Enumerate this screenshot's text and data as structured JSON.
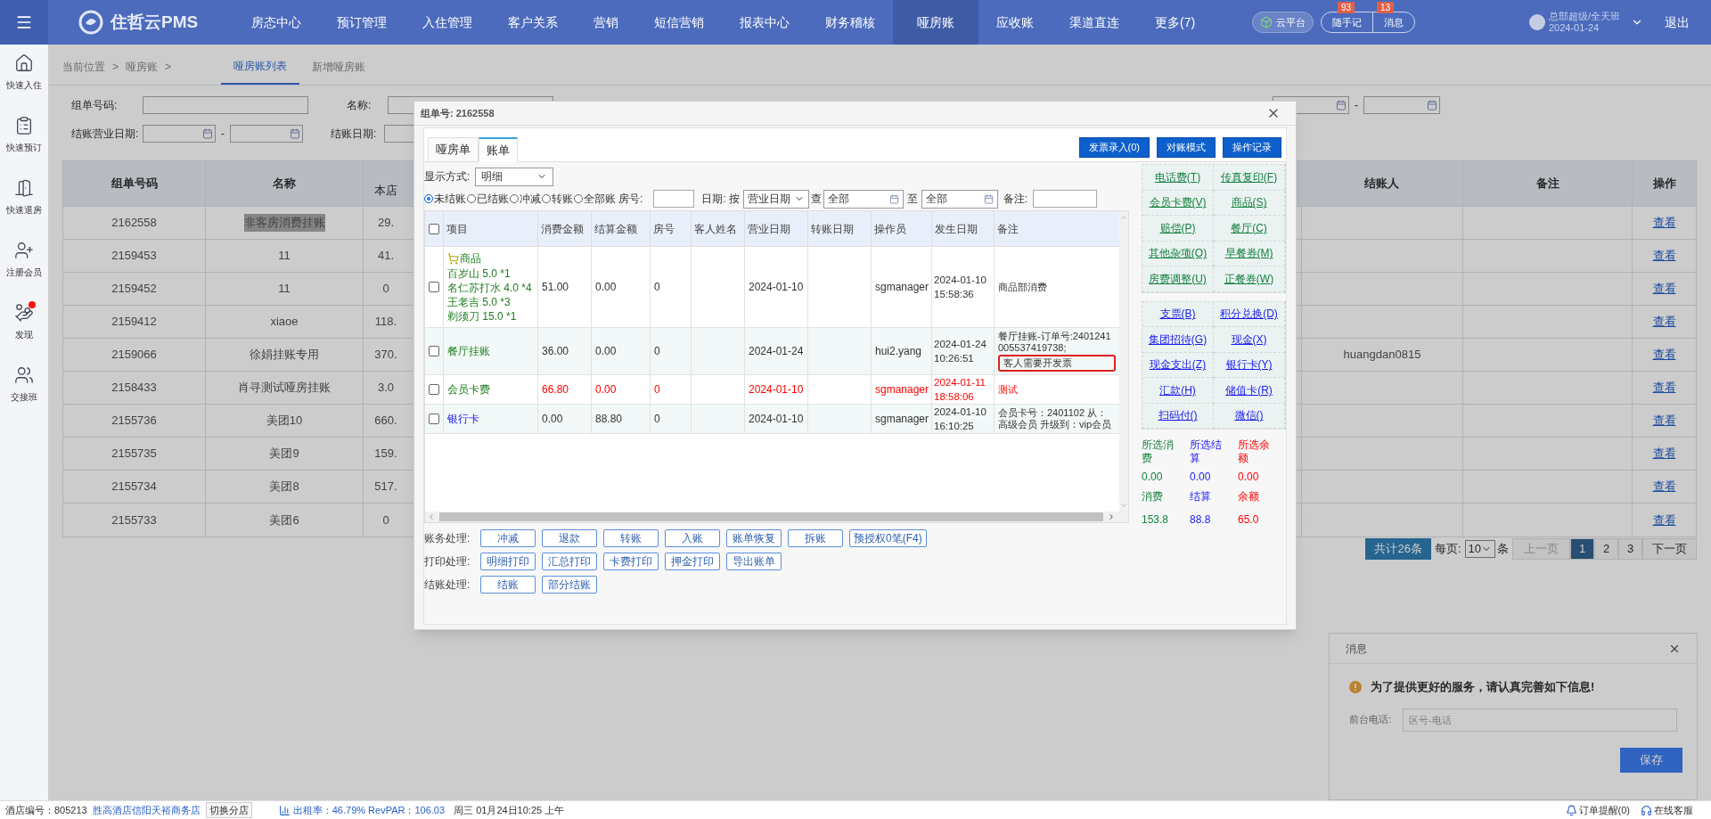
{
  "top_nav": {
    "logo": "住哲云PMS",
    "items": [
      {
        "label": "房态中心",
        "selected": false
      },
      {
        "label": "预订管理",
        "selected": false
      },
      {
        "label": "入住管理",
        "selected": false
      },
      {
        "label": "客户关系",
        "selected": false
      },
      {
        "label": "营销",
        "selected": false
      },
      {
        "label": "短信营销",
        "selected": false
      },
      {
        "label": "报表中心",
        "selected": false
      },
      {
        "label": "财务稽核",
        "selected": false
      },
      {
        "label": "哑房账",
        "selected": true
      },
      {
        "label": "应收账",
        "selected": false
      },
      {
        "label": "渠道直连",
        "selected": false
      },
      {
        "label": "更多(7)",
        "selected": false
      }
    ],
    "cloud": "云平台",
    "notes": {
      "label": "随手记",
      "count": "93"
    },
    "messages": {
      "label": "消息",
      "count": "13"
    },
    "user": {
      "name": "总部超级/全天班",
      "date": "2024-01-24"
    },
    "logout": "退出"
  },
  "sidebar": {
    "items": [
      {
        "label": "快速入住",
        "alert": false
      },
      {
        "label": "快速预订",
        "alert": false
      },
      {
        "label": "快速退房",
        "alert": false
      },
      {
        "label": "注册会员",
        "alert": false
      },
      {
        "label": "发现",
        "alert": true
      },
      {
        "label": "交接班",
        "alert": false
      }
    ]
  },
  "breadcrumb": {
    "items": [
      "当前位置",
      "哑房账"
    ],
    "separator": ">"
  },
  "page_tabs": [
    {
      "label": "哑房账列表",
      "selected": true
    },
    {
      "label": "新增哑房账",
      "selected": false
    }
  ],
  "filters": {
    "order_no_label": "组单号码:",
    "name_label": "名称:",
    "settle_business_date_label": "结账营业日期:",
    "settle_date_label": "结账日期:",
    "range_separators": [
      "-",
      "-"
    ]
  },
  "list_table": {
    "columns": [
      "组单号码",
      "名称",
      "本店",
      "结账人",
      "备注",
      "操作"
    ],
    "rows": [
      {
        "order_no": "2162558",
        "name": "非客房消费挂账",
        "name_selected": true,
        "amount": "29.",
        "action": "查看"
      },
      {
        "order_no": "2159453",
        "name": "11",
        "name_selected": false,
        "amount": "41.",
        "action": "查看"
      },
      {
        "order_no": "2159452",
        "name": "11",
        "name_selected": false,
        "amount": "0",
        "action": "查看"
      },
      {
        "order_no": "2159412",
        "name": "xiaoe",
        "name_selected": false,
        "amount": "118.",
        "action": "查看"
      },
      {
        "order_no": "2159066",
        "name": "徐娟挂账专用",
        "name_selected": false,
        "amount": "370.",
        "settler": "huangdan0815",
        "action": "查看"
      },
      {
        "order_no": "2158433",
        "name": "肖寻测试哑房挂账",
        "name_selected": false,
        "amount": "3.0",
        "action": "查看"
      },
      {
        "order_no": "2155736",
        "name": "美团10",
        "name_selected": false,
        "amount": "660.",
        "action": "查看"
      },
      {
        "order_no": "2155735",
        "name": "美团9",
        "name_selected": false,
        "amount": "159.",
        "action": "查看"
      },
      {
        "order_no": "2155734",
        "name": "美团8",
        "name_selected": false,
        "amount": "517.",
        "action": "查看"
      },
      {
        "order_no": "2155733",
        "name": "美团6",
        "name_selected": false,
        "amount": "0",
        "action": "查看"
      }
    ]
  },
  "pagination": {
    "total": "共计26条",
    "per_page_label": "每页:",
    "per_page": "10",
    "unit": "条",
    "prev": "上一页",
    "pages": [
      {
        "label": "1",
        "selected": true
      },
      {
        "label": "2",
        "selected": false
      },
      {
        "label": "3",
        "selected": false
      }
    ],
    "next": "下一页"
  },
  "dialog": {
    "title": "组单号: 2162558",
    "tabs": [
      {
        "label": "哑房单",
        "selected": false
      },
      {
        "label": "账单",
        "selected": true
      }
    ],
    "actions": [
      "发票录入(0)",
      "对账模式",
      "操作记录"
    ],
    "display_label": "显示方式:",
    "display_value": "明细",
    "scopes": [
      {
        "label": "未结账",
        "selected": true
      },
      {
        "label": "已结账",
        "selected": false
      },
      {
        "label": "冲减",
        "selected": false
      },
      {
        "label": "转账",
        "selected": false
      },
      {
        "label": "全部账",
        "selected": false
      }
    ],
    "room_label": "房号:",
    "date_label": "日期:",
    "by_label": "按",
    "date_type": "营业日期",
    "from_label": "查",
    "from": "全部",
    "to_label": "至",
    "to": "全部",
    "remark_label": "备注:",
    "all_checked": false,
    "columns": [
      "项目",
      "消费金额",
      "结算金额",
      "房号",
      "客人姓名",
      "营业日期",
      "转账日期",
      "操作员",
      "发生日期",
      "备注"
    ],
    "rows": [
      {
        "kind": "goods",
        "checked": false,
        "item": "商品",
        "lines": [
          "百岁山 5.0 *1",
          "名仁苏打水 4.0 *4",
          "王老吉 5.0 *3",
          "剃须刀 15.0 *1"
        ],
        "color": "#333333",
        "spent": "51.00",
        "settled": "0.00",
        "room": "0",
        "business_date": "2024-01-10",
        "operator": "sgmanager",
        "time": "2024-01-10 15:58:36",
        "remark": "商品部消费"
      },
      {
        "kind": "charge",
        "checked": false,
        "item": "餐厅挂账",
        "color": "#333333",
        "spent": "36.00",
        "settled": "0.00",
        "room": "0",
        "business_date": "2024-01-24",
        "operator": "hui2.yang",
        "time": "2024-01-24 10:26:51",
        "remark": "餐厅挂账-订单号:2401241005537419738;",
        "note": "客人需要开发票",
        "note_marked": true
      },
      {
        "kind": "charge",
        "checked": false,
        "item": "会员卡费",
        "color": "#ff0000",
        "spent": "66.80",
        "settled": "0.00",
        "room": "0",
        "business_date": "2024-01-10",
        "operator": "sgmanager",
        "time": "2024-01-11 18:58:06",
        "remark": "测试"
      },
      {
        "kind": "payment",
        "checked": false,
        "item": "银行卡",
        "color": "#333333",
        "spent": "0.00",
        "settled": "88.80",
        "room": "0",
        "business_date": "2024-01-10",
        "operator": "sgmanager",
        "time": "2024-01-10 16:10:25",
        "remark": "会员卡号：2401102 从：高级会员 升级到：vip会员"
      }
    ],
    "quick_groups": [
      {
        "color": "#13803f",
        "items": [
          "电话费(T)",
          "传真复印(F)",
          "会员卡费(V)",
          "商品(S)",
          "赔偿(P)",
          "餐厅(C)",
          "其他杂项(O)",
          "早餐券(M)",
          "房费调整(U)",
          "正餐券(W)"
        ]
      },
      {
        "color": "#1a1aee",
        "items": [
          "支票(B)",
          "积分兑换(D)",
          "集团招待(G)",
          "现金(X)",
          "现金支出(Z)",
          "银行卡(Y)",
          "汇款(H)",
          "储值卡(R)",
          "扫码付()",
          "微信()"
        ]
      }
    ],
    "selected_summary": [
      {
        "label": "所选消费",
        "value": "0.00"
      },
      {
        "label": "所选结算",
        "value": "0.00"
      },
      {
        "label": "所选余额",
        "value": "0.00"
      }
    ],
    "totals": [
      {
        "label": "消费",
        "value": "153.8"
      },
      {
        "label": "结算",
        "value": "88.8"
      },
      {
        "label": "余额",
        "value": "65.0"
      }
    ],
    "button_groups": [
      {
        "label": "账务处理:",
        "buttons": [
          "冲减",
          "退款",
          "转账",
          "入账",
          "账单恢复",
          "拆账",
          "预授权0笔(F4)"
        ]
      },
      {
        "label": "打印处理:",
        "buttons": [
          "明细打印",
          "汇总打印",
          "卡费打印",
          "押金打印",
          "导出账单"
        ]
      },
      {
        "label": "结账处理:",
        "buttons": [
          "结账",
          "部分结账"
        ]
      }
    ]
  },
  "message_panel": {
    "title": "消息",
    "notice": "为了提供更好的服务，请认真完善如下信息!",
    "phone_label": "前台电话:",
    "placeholder": "区号-电话",
    "save": "保存"
  },
  "status_bar": {
    "hotel_no": "酒店编号：805213",
    "hotel_name": "胜高酒店信阳天裕商务店",
    "switch": "切换分店",
    "stats": "出租率：46.79% RevPAR：106.03",
    "datetime": "周三 01月24日10:25 上午",
    "order_alert": "订单提醒(0)",
    "service": "在线客服"
  }
}
